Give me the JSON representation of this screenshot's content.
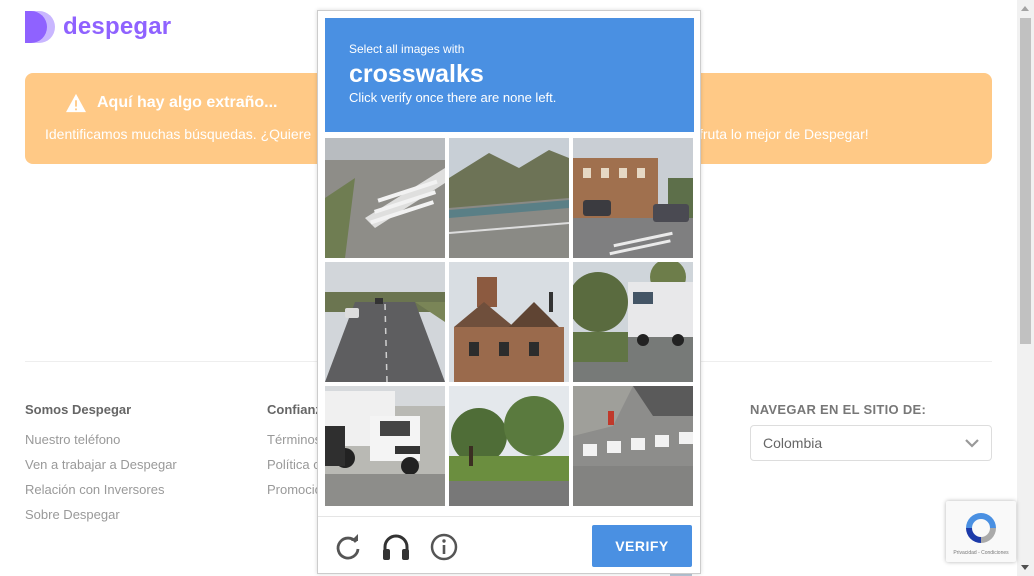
{
  "site": {
    "logo_text": "despegar",
    "brand_color": "#8f62ff"
  },
  "banner": {
    "title": "Aquí hay algo extraño...",
    "message": "Identificamos muchas búsquedas. ¿Quiere",
    "message_tail": "fruta lo mejor de Despegar!",
    "color": "#ffc986",
    "icon": "warning-icon"
  },
  "footer": {
    "col1": {
      "heading": "Somos Despegar",
      "links": [
        "Nuestro teléfono",
        "Ven a trabajar a Despegar",
        "Relación con Inversores",
        "Sobre Despegar"
      ]
    },
    "col2": {
      "heading": "Confianz",
      "links": [
        "Términos",
        "Política c",
        "Promocio"
      ]
    },
    "nav_site": {
      "heading": "NAVEGAR EN EL SITIO DE:",
      "selected": "Colombia"
    }
  },
  "captcha": {
    "instruction_small": "Select all images with",
    "target": "crosswalks",
    "instruction_sub": "Click verify once there are none left.",
    "verify_label": "VERIFY",
    "accent": "#4a90e2",
    "controls": [
      "reload-icon",
      "headphones-icon",
      "info-icon"
    ]
  },
  "recaptcha_badge": {
    "text": "Privacidad - Condiciones"
  }
}
